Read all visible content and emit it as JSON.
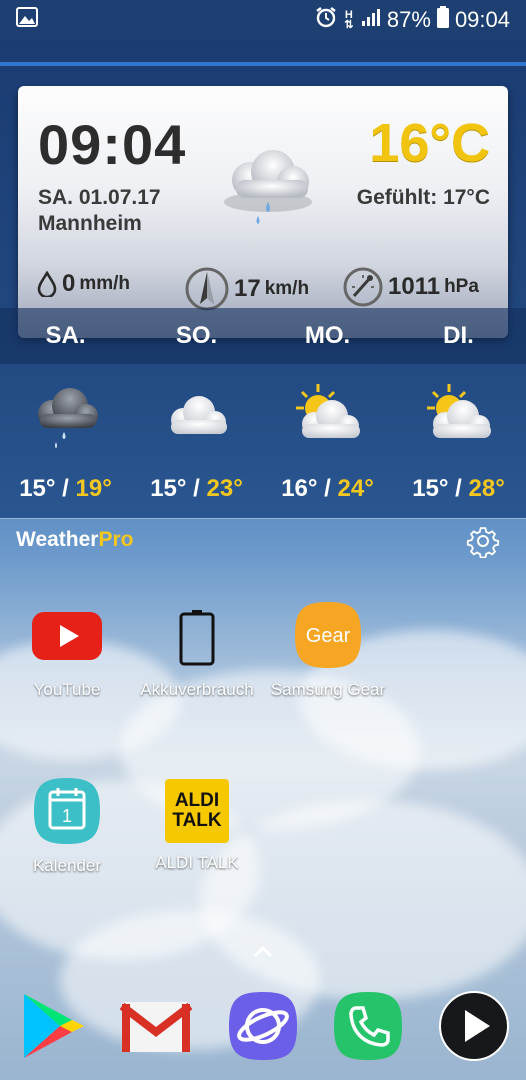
{
  "status_bar": {
    "battery_percent": "87%",
    "time": "09:04",
    "network_label": "H"
  },
  "weather_widget": {
    "time": "09:04",
    "date": "SA. 01.07.17",
    "city": "Mannheim",
    "temperature": "16°C",
    "feels_like": "Gefühlt: 17°C",
    "precipitation": {
      "value": "0",
      "unit": "mm/h"
    },
    "wind": {
      "value": "17",
      "unit": "km/h"
    },
    "pressure": {
      "value": "1011",
      "unit": "hPa"
    },
    "forecast": [
      {
        "day": "SA.",
        "low": "15°",
        "high": "19°",
        "icon": "rain-cloud-icon"
      },
      {
        "day": "SO.",
        "low": "15°",
        "high": "23°",
        "icon": "cloud-icon"
      },
      {
        "day": "MO.",
        "low": "16°",
        "high": "24°",
        "icon": "sun-cloud-icon"
      },
      {
        "day": "DI.",
        "low": "15°",
        "high": "28°",
        "icon": "sun-cloud-icon"
      }
    ],
    "brand": {
      "name": "Weather",
      "suffix": "Pro"
    }
  },
  "apps": [
    {
      "label": "YouTube",
      "icon": "youtube-icon"
    },
    {
      "label": "Akkuverbrauch",
      "icon": "battery-icon"
    },
    {
      "label": "Samsung Gear",
      "icon": "gear-app-icon",
      "icon_text": "Gear"
    },
    {
      "label": "Kalender",
      "icon": "calendar-icon",
      "icon_text": "1"
    },
    {
      "label": "ALDI TALK",
      "icon": "aldi-talk-icon",
      "icon_text": "ALDI TALK"
    }
  ],
  "dock": [
    {
      "icon": "play-store-icon"
    },
    {
      "icon": "gmail-icon"
    },
    {
      "icon": "internet-icon"
    },
    {
      "icon": "phone-icon"
    },
    {
      "icon": "media-play-icon"
    }
  ],
  "colors": {
    "accent_yellow": "#f3c720",
    "status_bar": "#1d3f72"
  }
}
